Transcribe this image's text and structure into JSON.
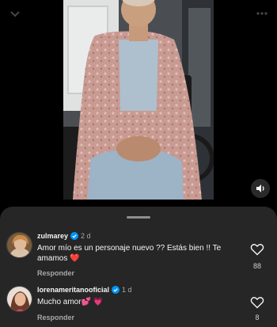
{
  "comments": [
    {
      "username": "zulmarey",
      "age": "2 d",
      "text": "Amor mío es un personaje nuevo ?? Estás bien !! Te amamos ❤️",
      "reply_label": "Responder",
      "like_count": "88"
    },
    {
      "username": "lorenameritanooficial",
      "age": "1 d",
      "text": "Mucho amor💕 💗",
      "reply_label": "Responder",
      "like_count": "8"
    }
  ],
  "colors": {
    "sheet_bg": "#262626",
    "verified_blue": "#0095f6",
    "secondary_text": "#a8a8a8"
  },
  "icons": [
    "chevron-down-icon",
    "more-icon",
    "speaker-icon",
    "verified-icon",
    "heart-outline-icon"
  ]
}
